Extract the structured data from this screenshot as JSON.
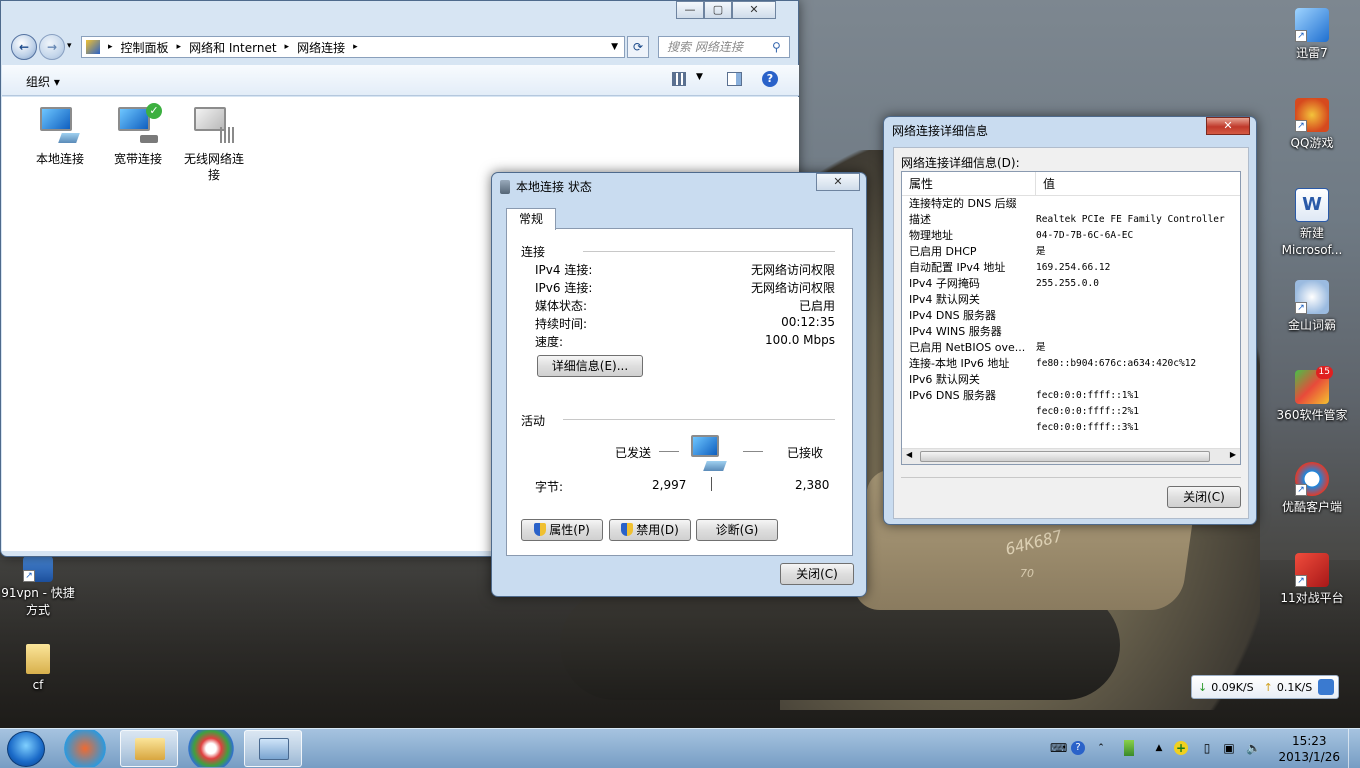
{
  "explorer": {
    "breadcrumb": [
      "控制面板",
      "网络和 Internet",
      "网络连接"
    ],
    "search_placeholder": "搜索 网络连接",
    "organize": "组织 ▾",
    "items": [
      {
        "label": "本地连接",
        "icon": "wired-connection-icon"
      },
      {
        "label": "宽带连接",
        "icon": "broadband-connection-icon"
      },
      {
        "label": "无线网络连接",
        "icon": "wireless-connection-icon"
      }
    ]
  },
  "status_dialog": {
    "title": "本地连接 状态",
    "tab": "常规",
    "connection_group": "连接",
    "rows": [
      {
        "k": "IPv4 连接:",
        "v": "无网络访问权限"
      },
      {
        "k": "IPv6 连接:",
        "v": "无网络访问权限"
      },
      {
        "k": "媒体状态:",
        "v": "已启用"
      },
      {
        "k": "持续时间:",
        "v": "00:12:35"
      },
      {
        "k": "速度:",
        "v": "100.0 Mbps"
      }
    ],
    "details_button": "详细信息(E)...",
    "activity_group": "活动",
    "sent_label": "已发送",
    "received_label": "已接收",
    "bytes_label": "字节:",
    "bytes_sent": "2,997",
    "bytes_received": "2,380",
    "properties_button": "属性(P)",
    "disable_button": "禁用(D)",
    "diagnose_button": "诊断(G)",
    "close_button": "关闭(C)"
  },
  "details_dialog": {
    "title": "网络连接详细信息",
    "label": "网络连接详细信息(D):",
    "col_property": "属性",
    "col_value": "值",
    "rows": [
      {
        "k": "连接特定的 DNS 后缀",
        "v": ""
      },
      {
        "k": "描述",
        "v": "Realtek PCIe FE Family Controller"
      },
      {
        "k": "物理地址",
        "v": "04-7D-7B-6C-6A-EC"
      },
      {
        "k": "已启用 DHCP",
        "v": "是"
      },
      {
        "k": "自动配置 IPv4 地址",
        "v": "169.254.66.12"
      },
      {
        "k": "IPv4 子网掩码",
        "v": "255.255.0.0"
      },
      {
        "k": "IPv4 默认网关",
        "v": ""
      },
      {
        "k": "IPv4 DNS 服务器",
        "v": ""
      },
      {
        "k": "IPv4 WINS 服务器",
        "v": ""
      },
      {
        "k": "已启用 NetBIOS ove...",
        "v": "是"
      },
      {
        "k": "连接-本地 IPv6 地址",
        "v": "fe80::b904:676c:a634:420c%12"
      },
      {
        "k": "IPv6 默认网关",
        "v": ""
      },
      {
        "k": "IPv6 DNS 服务器",
        "v": "fec0:0:0:ffff::1%1"
      },
      {
        "k": "",
        "v": "fec0:0:0:ffff::2%1"
      },
      {
        "k": "",
        "v": "fec0:0:0:ffff::3%1"
      }
    ],
    "close_button": "关闭(C)"
  },
  "desktop_icons_right": [
    {
      "label": "迅雷7",
      "icon": "xunlei-icon"
    },
    {
      "label": "QQ游戏",
      "icon": "qq-game-icon"
    },
    {
      "label": "新建 Microsof...",
      "icon": "word-document-icon"
    },
    {
      "label": "金山词霸",
      "icon": "kingsoft-dictionary-icon"
    },
    {
      "label": "360软件管家",
      "icon": "360-software-manager-icon"
    },
    {
      "label": "优酷客户端",
      "icon": "youku-icon"
    },
    {
      "label": "11对战平台",
      "icon": "11-battle-platform-icon"
    }
  ],
  "desktop_icons_left": [
    {
      "label": "91vpn - 快捷方式",
      "icon": "vpn-shortcut-icon"
    },
    {
      "label": "cf",
      "icon": "folder-icon"
    }
  ],
  "badge_360": "15",
  "tank_marking": "64K687",
  "tank_number": "70",
  "net_speed": {
    "down": "0.09K/S",
    "up": "0.1K/S"
  },
  "clock": {
    "time": "15:23",
    "date": "2013/1/26"
  }
}
